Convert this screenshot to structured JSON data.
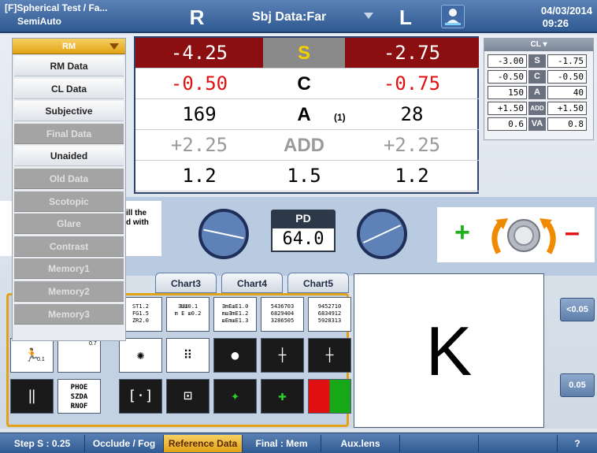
{
  "topbar": {
    "title": "[F]Spherical Test / Fa...",
    "subtitle": "SemiAuto",
    "right_eye": "R",
    "mode": "Sbj Data:Far",
    "left_eye": "L",
    "date": "04/03/2014",
    "time": "09:26"
  },
  "menu": {
    "header": "RM",
    "items": [
      {
        "label": "RM Data",
        "enabled": true
      },
      {
        "label": "CL Data",
        "enabled": true
      },
      {
        "label": "Subjective",
        "enabled": true
      },
      {
        "label": "Final Data",
        "enabled": false
      },
      {
        "label": "Unaided",
        "enabled": true
      },
      {
        "label": "Old Data",
        "enabled": false
      },
      {
        "label": "Scotopic",
        "enabled": false
      },
      {
        "label": "Glare",
        "enabled": false
      },
      {
        "label": "Contrast",
        "enabled": false
      },
      {
        "label": "Memory1",
        "enabled": false
      },
      {
        "label": "Memory2",
        "enabled": false
      },
      {
        "label": "Memory3",
        "enabled": false
      }
    ]
  },
  "rx": {
    "rows": [
      {
        "right": "-4.25",
        "label": "S",
        "left": "-2.75"
      },
      {
        "right": "-0.50",
        "label": "C",
        "left": "-0.75"
      },
      {
        "right": "169",
        "label": "A",
        "label_note": "(1)",
        "left": "28"
      },
      {
        "right": "+2.25",
        "label": "ADD",
        "left": "+2.25"
      },
      {
        "right": "1.2",
        "label": "1.5",
        "left": "1.2"
      }
    ]
  },
  "cl_panel": {
    "header": "CL",
    "rows": [
      {
        "right": "-3.00",
        "label": "S",
        "left": "-1.75"
      },
      {
        "right": "-0.50",
        "label": "C",
        "left": "-0.50"
      },
      {
        "right": "150",
        "label": "A",
        "left": "40"
      },
      {
        "right": "+1.50",
        "label": "ADD",
        "left": "+1.50"
      },
      {
        "right": "0.6",
        "label": "VA",
        "left": "0.8"
      }
    ]
  },
  "info": {
    "text1": "ill the",
    "text2": "d with"
  },
  "pd": {
    "label": "PD",
    "value": "64.0"
  },
  "chart_tabs": [
    "Chart3",
    "Chart4",
    "Chart5"
  ],
  "charts": {
    "row1": [
      {
        "lines": [
          "ST1.2",
          "FG1.5",
          "ZR2.0"
        ]
      },
      {
        "lines": [
          "ƎШШ0.1",
          "m E ш0.2"
        ]
      },
      {
        "lines": [
          "ƎmEшE1.0",
          "mшƎmE1.2",
          "шEmшE1.3"
        ]
      },
      {
        "lines": [
          "5436703",
          "6829404",
          "3286505"
        ]
      },
      {
        "lines": [
          "9452710",
          "6834912",
          "5928313"
        ]
      }
    ],
    "row2_labels": [
      "0.1",
      "0.7"
    ],
    "row3": [
      {
        "lines": [
          "PHOE",
          "SZDA",
          "RNOF"
        ]
      }
    ]
  },
  "target_letter": "K",
  "side_buttons": [
    "<0.05",
    "0.05"
  ],
  "bottom": [
    {
      "label": "Step S : 0.25"
    },
    {
      "label": "Occlude / Fog"
    },
    {
      "label": "Reference Data",
      "active": true
    },
    {
      "label": "Final : Mem"
    },
    {
      "label": "Aux.lens"
    },
    {
      "label": ""
    },
    {
      "label": ""
    },
    {
      "label": "?"
    }
  ],
  "colors": {
    "accent": "#e2a215",
    "rx_highlight": "#8b0f10",
    "minus_red": "#e01010",
    "plus_green": "#1fb21f"
  }
}
